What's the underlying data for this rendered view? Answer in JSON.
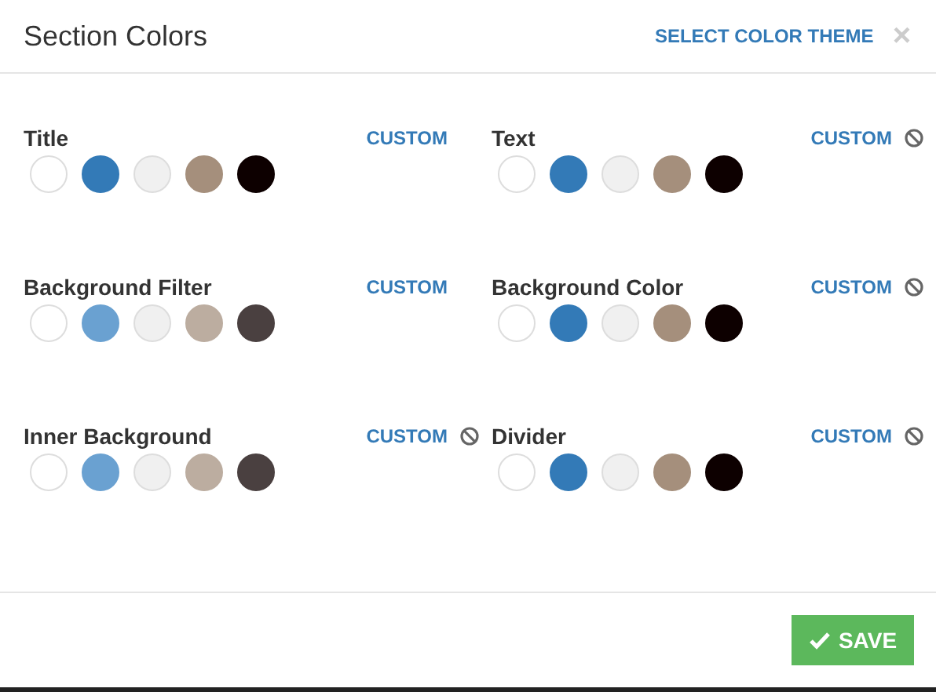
{
  "window": {
    "title": "Section Colors",
    "theme_link": "SELECT COLOR THEME",
    "close": "×"
  },
  "sections": [
    {
      "label": "Title",
      "custom": "CUSTOM",
      "resettable": false,
      "swatches": [
        {
          "color": "#ffffff"
        },
        {
          "color": "#337ab7"
        },
        {
          "color": "#f0f0f0"
        },
        {
          "color": "#a58f7c"
        },
        {
          "color": "#0d0000"
        }
      ]
    },
    {
      "label": "Text",
      "custom": "CUSTOM",
      "resettable": true,
      "swatches": [
        {
          "color": "#ffffff"
        },
        {
          "color": "#337ab7"
        },
        {
          "color": "#f0f0f0"
        },
        {
          "color": "#a58f7c"
        },
        {
          "color": "#0d0000"
        }
      ]
    },
    {
      "label": "Background Filter",
      "custom": "CUSTOM",
      "resettable": false,
      "swatches": [
        {
          "color": "#ffffff"
        },
        {
          "color": "#6aa1d1"
        },
        {
          "color": "#f0f0f0"
        },
        {
          "color": "#bcada0"
        },
        {
          "color": "#4a4040"
        }
      ]
    },
    {
      "label": "Background Color",
      "custom": "CUSTOM",
      "resettable": true,
      "swatches": [
        {
          "color": "#ffffff"
        },
        {
          "color": "#337ab7"
        },
        {
          "color": "#f0f0f0"
        },
        {
          "color": "#a58f7c"
        },
        {
          "color": "#0d0000"
        }
      ]
    },
    {
      "label": "Inner Background",
      "custom": "CUSTOM",
      "resettable": true,
      "swatches": [
        {
          "color": "#ffffff"
        },
        {
          "color": "#6aa1d1"
        },
        {
          "color": "#f0f0f0"
        },
        {
          "color": "#bcada0"
        },
        {
          "color": "#4a4040"
        }
      ]
    },
    {
      "label": "Divider",
      "custom": "CUSTOM",
      "resettable": true,
      "swatches": [
        {
          "color": "#ffffff"
        },
        {
          "color": "#337ab7"
        },
        {
          "color": "#f0f0f0"
        },
        {
          "color": "#a58f7c"
        },
        {
          "color": "#0d0000"
        }
      ]
    }
  ],
  "save_button": "SAVE"
}
